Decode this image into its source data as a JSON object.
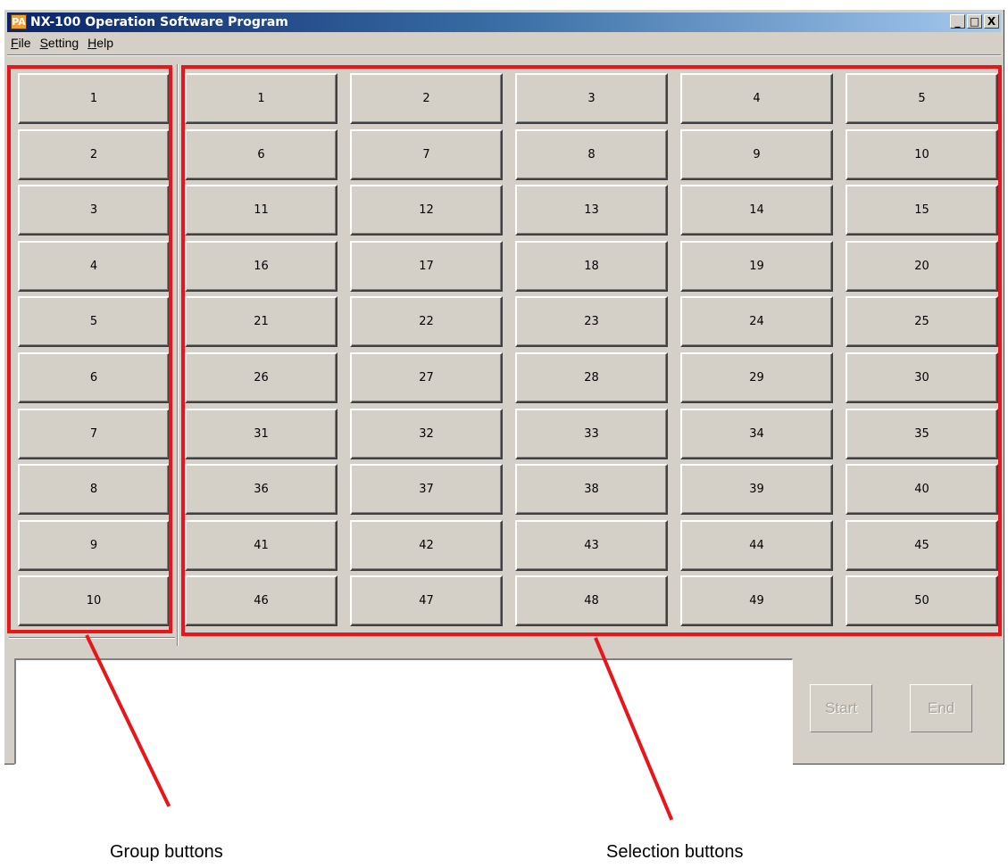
{
  "window": {
    "title": "NX-100 Operation Software Program",
    "icon_label": "PA",
    "controls": {
      "minimize": "_",
      "maximize": "□",
      "close": "X"
    }
  },
  "menu": [
    {
      "label": "File",
      "accel": "F",
      "rest": "ile"
    },
    {
      "label": "Setting",
      "accel": "S",
      "rest": "etting"
    },
    {
      "label": "Help",
      "accel": "H",
      "rest": "elp"
    }
  ],
  "group_buttons": [
    "1",
    "2",
    "3",
    "4",
    "5",
    "6",
    "7",
    "8",
    "9",
    "10"
  ],
  "selection_buttons": [
    "1",
    "2",
    "3",
    "4",
    "5",
    "6",
    "7",
    "8",
    "9",
    "10",
    "11",
    "12",
    "13",
    "14",
    "15",
    "16",
    "17",
    "18",
    "19",
    "20",
    "21",
    "22",
    "23",
    "24",
    "25",
    "26",
    "27",
    "28",
    "29",
    "30",
    "31",
    "32",
    "33",
    "34",
    "35",
    "36",
    "37",
    "38",
    "39",
    "40",
    "41",
    "42",
    "43",
    "44",
    "45",
    "46",
    "47",
    "48",
    "49",
    "50"
  ],
  "actions": {
    "start": "Start",
    "end": "End"
  },
  "annotations": {
    "group_caption": "Group buttons",
    "selection_caption": "Selection buttons",
    "highlight_color": "#e8161b"
  }
}
